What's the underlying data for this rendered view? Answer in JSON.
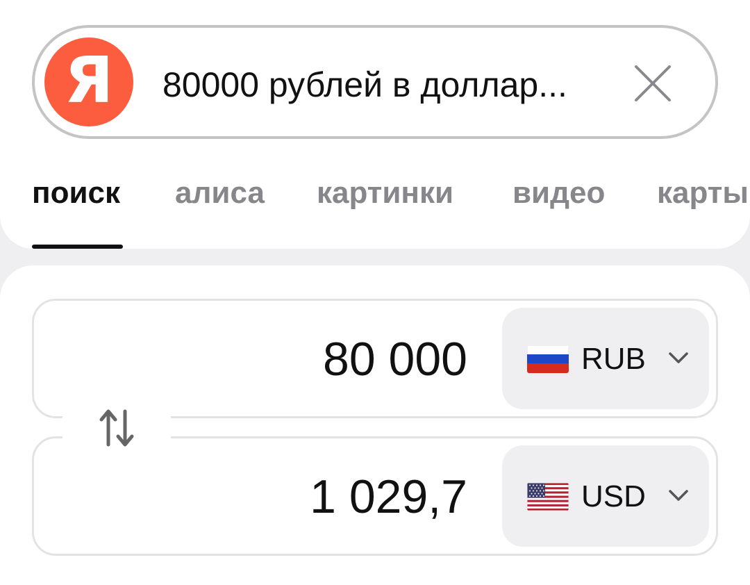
{
  "search": {
    "logo_letter": "Я",
    "query": "80000 рублей в доллар...",
    "brand_color": "#fc5d3f"
  },
  "tabs": [
    {
      "label": "поиск",
      "active": true
    },
    {
      "label": "алиса",
      "active": false
    },
    {
      "label": "картинки",
      "active": false
    },
    {
      "label": "видео",
      "active": false
    },
    {
      "label": "карты",
      "active": false
    }
  ],
  "converter": {
    "from": {
      "amount": "80 000",
      "currency": "RUB",
      "flag": "russia-flag"
    },
    "to": {
      "amount": "1 029,7",
      "currency": "USD",
      "flag": "usa-flag"
    }
  },
  "icons": {
    "clear": "close-icon",
    "swap": "swap-arrows-icon",
    "dropdown": "chevron-down-icon"
  }
}
